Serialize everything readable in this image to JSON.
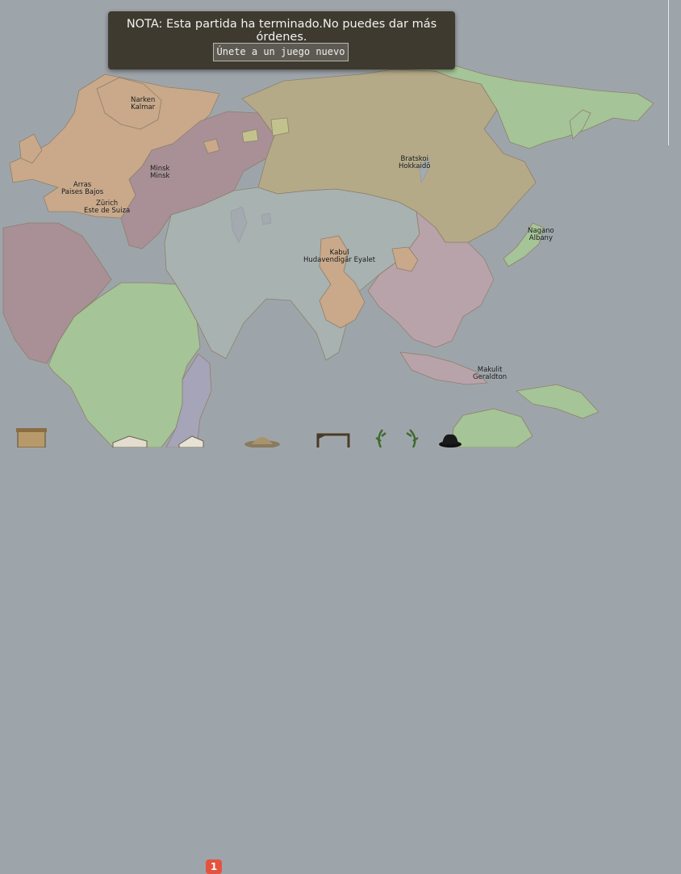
{
  "notice": {
    "message": "NOTA: Esta partida ha terminado.No puedes dar más órdenes.",
    "button_label": "Únete a un juego nuevo"
  },
  "colors": {
    "sea": "#9ea5aa",
    "territory_europe": "#c9a98a",
    "territory_russia": "#b5aa88",
    "territory_mauve": "#a89096",
    "territory_central_asia": "#a8b2b0",
    "territory_china": "#b9a3aa",
    "territory_green": "#a5c497",
    "territory_lilac": "#a5a4b8",
    "notice_bg": "#3e3a30",
    "alert_badge": "#e5533e"
  },
  "cities": [
    {
      "id": "narken",
      "lines": [
        "Narken",
        "Kalmar"
      ]
    },
    {
      "id": "minsk",
      "lines": [
        "Minsk",
        "Minsk"
      ]
    },
    {
      "id": "arras",
      "lines": [
        "Arras",
        "Paises Bajos"
      ]
    },
    {
      "id": "zurich",
      "lines": [
        "Zürich",
        "Este de Suiza"
      ]
    },
    {
      "id": "bratskoi",
      "lines": [
        "Bratskoi",
        "Hokkaidō"
      ]
    },
    {
      "id": "nagano",
      "lines": [
        "Nagano",
        "Albany"
      ]
    },
    {
      "id": "kabul",
      "lines": [
        "Kabul",
        "Hudavendigâr Eyalet"
      ]
    },
    {
      "id": "makulit",
      "lines": [
        "Makulit",
        "Geraldton"
      ]
    }
  ],
  "toolbar": {
    "alert_count": "1",
    "items": [
      "scroll-icon",
      "book-icon",
      "letter-icon",
      "hat-icon",
      "gallows-icon",
      "laurel-icon",
      "laurel-icon",
      "spy-hat-icon"
    ]
  }
}
